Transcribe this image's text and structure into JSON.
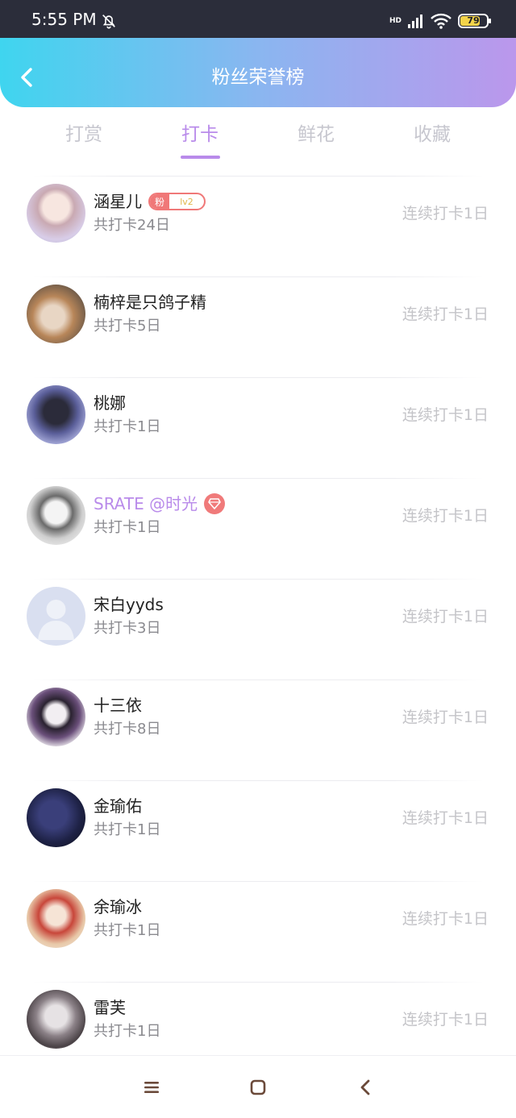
{
  "status": {
    "time": "5:55 PM",
    "network": "HD",
    "battery": "79",
    "icons": [
      "bell-off-icon",
      "signal-icon",
      "wifi-icon",
      "battery-icon"
    ]
  },
  "header": {
    "title": "粉丝荣誉榜",
    "back_icon": "chevron-left-icon",
    "gradient": [
      "#3fd5ef",
      "#bb97ec"
    ]
  },
  "tabs": [
    {
      "label": "打赏",
      "active": false
    },
    {
      "label": "打卡",
      "active": true
    },
    {
      "label": "鲜花",
      "active": false
    },
    {
      "label": "收藏",
      "active": false
    }
  ],
  "colors": {
    "accent": "#b98bea",
    "badge": "#f07878"
  },
  "fans": [
    {
      "name": "涵星儿",
      "total": "共打卡24日",
      "streak": "连续打卡1日",
      "badge": {
        "fan": "粉",
        "level": "lv2"
      }
    },
    {
      "name": "楠梓是只鸽子精",
      "total": "共打卡5日",
      "streak": "连续打卡1日"
    },
    {
      "name": "桃娜",
      "total": "共打卡1日",
      "streak": "连续打卡1日"
    },
    {
      "name": "SRATE @时光",
      "total": "共打卡1日",
      "streak": "连续打卡1日",
      "vip_icon": "gem-icon"
    },
    {
      "name": "宋白yyds",
      "total": "共打卡3日",
      "streak": "连续打卡1日"
    },
    {
      "name": "十三依",
      "total": "共打卡8日",
      "streak": "连续打卡1日"
    },
    {
      "name": "金瑜佑",
      "total": "共打卡1日",
      "streak": "连续打卡1日"
    },
    {
      "name": "余瑜冰",
      "total": "共打卡1日",
      "streak": "连续打卡1日"
    },
    {
      "name": "雷芙",
      "total": "共打卡1日",
      "streak": "连续打卡1日"
    }
  ],
  "navbar": {
    "icons": [
      "menu-icon",
      "home-icon",
      "back-icon"
    ]
  }
}
